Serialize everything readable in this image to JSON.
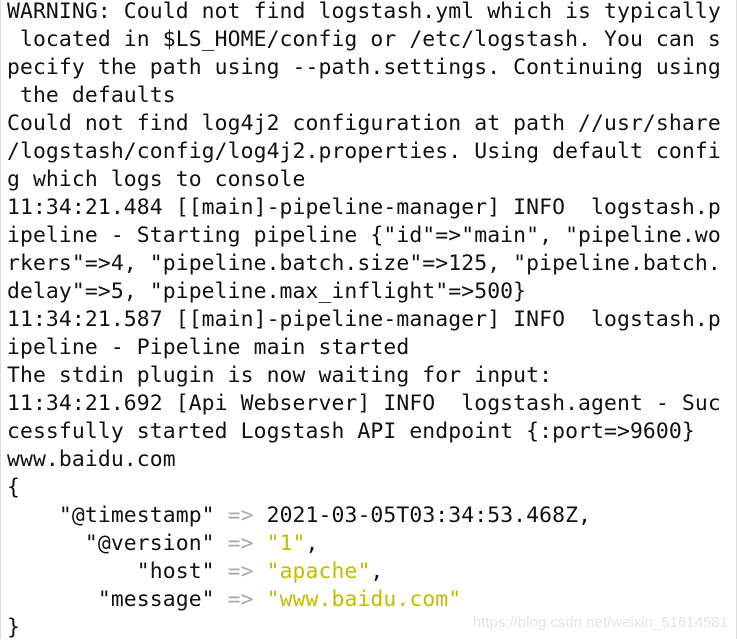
{
  "terminal": {
    "output_lines": [
      "WARNING: Could not find logstash.yml which is typically",
      " located in $LS_HOME/config or /etc/logstash. You can s",
      "pecify the path using --path.settings. Continuing using",
      " the defaults",
      "Could not find log4j2 configuration at path //usr/share",
      "/logstash/config/log4j2.properties. Using default confi",
      "g which logs to console",
      "11:34:21.484 [[main]-pipeline-manager] INFO  logstash.p",
      "ipeline - Starting pipeline {\"id\"=>\"main\", \"pipeline.wo",
      "rkers\"=>4, \"pipeline.batch.size\"=>125, \"pipeline.batch.",
      "delay\"=>5, \"pipeline.max_inflight\"=>500}",
      "11:34:21.587 [[main]-pipeline-manager] INFO  logstash.p",
      "ipeline - Pipeline main started",
      "The stdin plugin is now waiting for input:",
      "11:34:21.692 [Api Webserver] INFO  logstash.agent - Suc",
      "cessfully started Logstash API endpoint {:port=>9600}",
      "www.baidu.com",
      "{"
    ],
    "event": [
      {
        "key": "    \"@timestamp\" ",
        "arrow": "=>",
        "value": "2021-03-05T03:34:53.468Z",
        "string": false,
        "suffix": ","
      },
      {
        "key": "      \"@version\" ",
        "arrow": "=>",
        "value": "\"1\"",
        "string": true,
        "suffix": ","
      },
      {
        "key": "          \"host\" ",
        "arrow": "=>",
        "value": "\"apache\"",
        "string": true,
        "suffix": ","
      },
      {
        "key": "       \"message\" ",
        "arrow": "=>",
        "value": "\"www.baidu.com\"",
        "string": true,
        "suffix": ""
      }
    ],
    "closing": "}"
  },
  "watermark": "https://blog.csdn.net/weixin_51614581",
  "colors": {
    "string": "#c4bc00",
    "arrow": "#aaaaaa",
    "text": "#111111"
  }
}
